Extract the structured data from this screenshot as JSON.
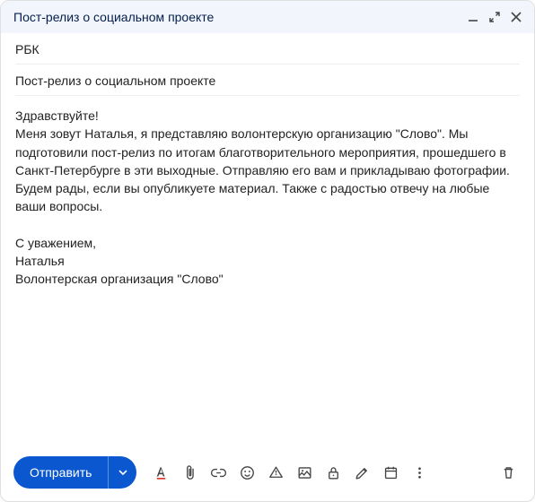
{
  "header": {
    "title": "Пост-релиз о социальном проекте"
  },
  "fields": {
    "to": "РБК",
    "subject": "Пост-релиз о социальном проекте"
  },
  "body": {
    "greeting": "Здравствуйте!",
    "line1": "Меня зовут Наталья, я представляю волонтерскую организацию \"Слово\". Мы подготовили пост-релиз по итогам благотворительного мероприятия, прошедшего в Санкт-Петербурге в эти выходные. Отправляю его вам и прикладываю фотографии.",
    "line2": "Будем рады, если вы опубликуете материал. Также с радостью отвечу на любые ваши вопросы.",
    "signoff1": "С уважением,",
    "signoff2": "Наталья",
    "signoff3": "Волонтерская организация \"Слово\""
  },
  "toolbar": {
    "send_label": "Отправить"
  },
  "icons": {
    "minimize": "minimize-icon",
    "expand": "expand-icon",
    "close": "close-icon",
    "format": "format-text-icon",
    "attach": "attachment-icon",
    "link": "link-icon",
    "emoji": "emoji-icon",
    "drive": "drive-icon",
    "image": "image-icon",
    "confidential": "lock-clock-icon",
    "signature": "pen-icon",
    "schedule": "calendar-icon",
    "more": "more-icon",
    "trash": "trash-icon"
  }
}
